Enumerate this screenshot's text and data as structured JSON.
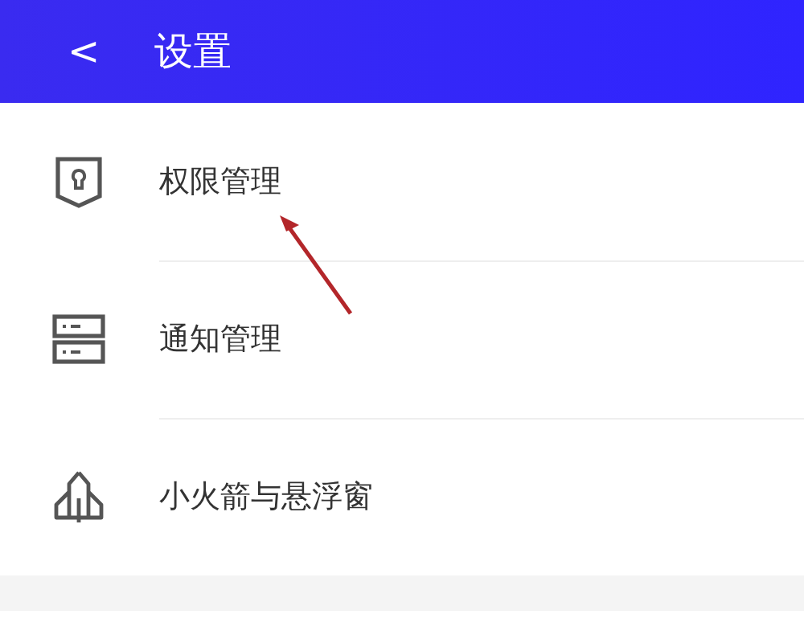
{
  "header": {
    "back": "<",
    "title": "设置"
  },
  "items": [
    {
      "label": "权限管理"
    },
    {
      "label": "通知管理"
    },
    {
      "label": "小火箭与悬浮窗"
    }
  ]
}
